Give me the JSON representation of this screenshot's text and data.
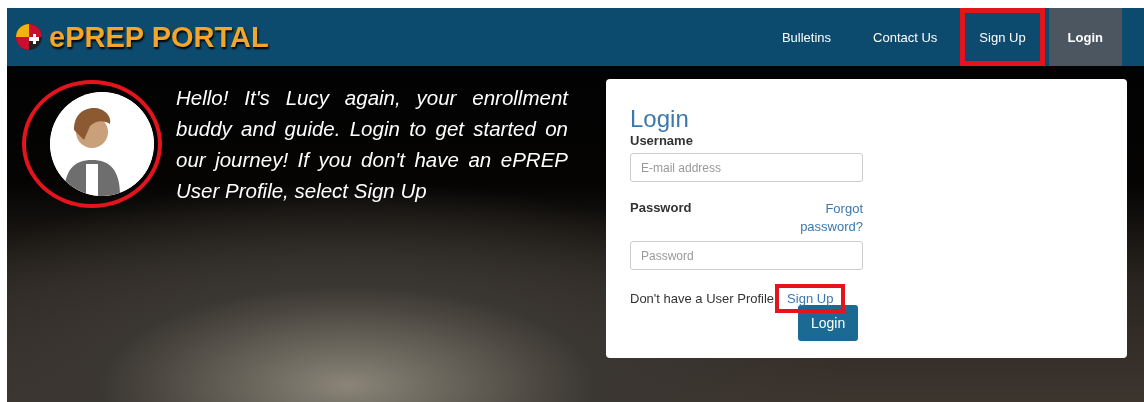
{
  "header": {
    "logo_text": "ePREP PORTAL",
    "nav": [
      {
        "label": "Bulletins",
        "selected": false,
        "highlighted": false
      },
      {
        "label": "Contact Us",
        "selected": false,
        "highlighted": false
      },
      {
        "label": "Sign Up",
        "selected": false,
        "highlighted": true
      },
      {
        "label": "Login",
        "selected": true,
        "highlighted": false
      }
    ]
  },
  "hero": {
    "avatar": {
      "highlighted": true
    },
    "message": "Hello! It's Lucy again, your enrollment buddy and guide. Login to get started on our journey! If you don't have an ePREP User Profile, select Sign Up"
  },
  "login_card": {
    "title": "Login",
    "username": {
      "label": "Username",
      "placeholder": "E-mail address"
    },
    "password": {
      "label": "Password",
      "placeholder": "Password"
    },
    "forgot_link": "Forgot password?",
    "signup_prompt": "Don't have a User Profile",
    "signup_link": {
      "label": "Sign Up",
      "highlighted": true
    },
    "login_button": "Login"
  }
}
